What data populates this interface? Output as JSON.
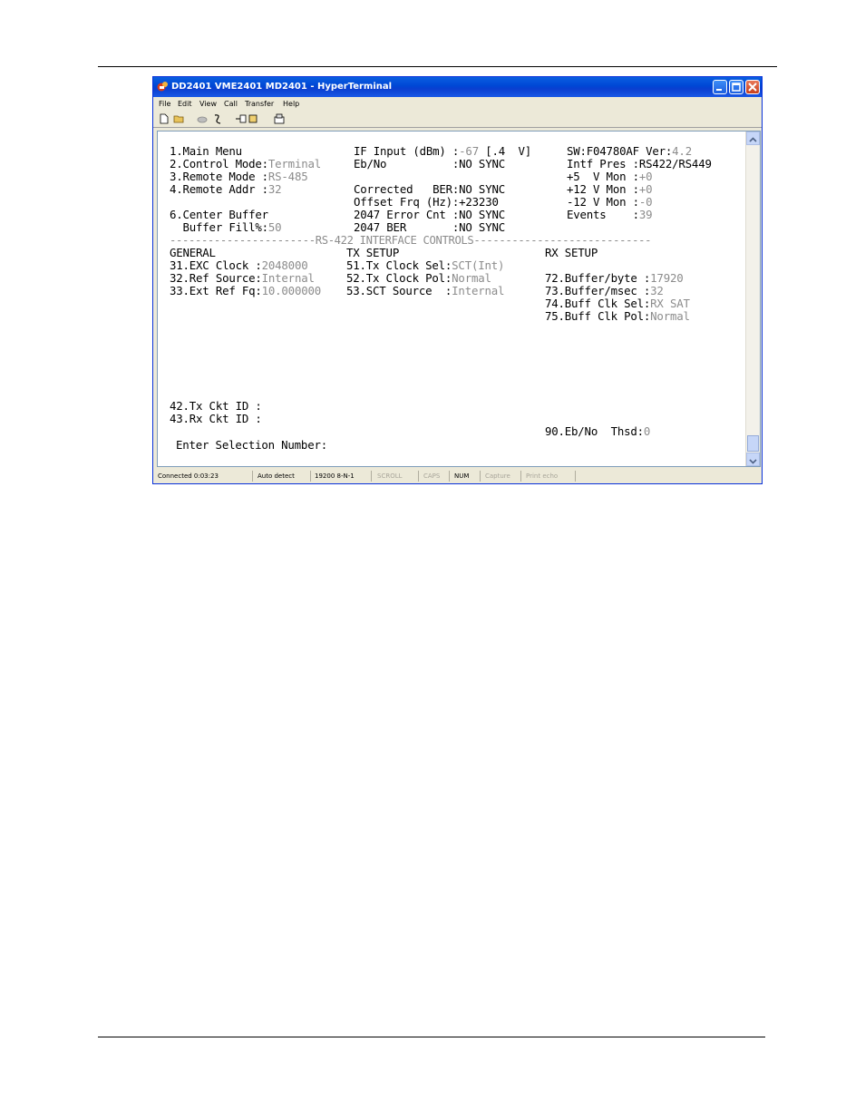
{
  "window": {
    "title": "DD2401 VME2401 MD2401 - HyperTerminal"
  },
  "menu": [
    "File",
    "Edit",
    "View",
    "Call",
    "Transfer",
    "Help"
  ],
  "toolbar_icons": [
    "new-icon",
    "open-icon",
    "dial-icon",
    "disconnect-icon",
    "send-icon",
    "properties-icon"
  ],
  "terminal": {
    "r1": {
      "a": "1.Main Menu",
      "b": "IF Input (dBm) :",
      "c": "-67",
      "d": " [.4  V]",
      "e": "SW:F04780AF Ver:",
      "f": "4.2"
    },
    "r2": {
      "a": "2.Control Mode:",
      "b": "Terminal",
      "c": "Eb/No          :NO SYNC",
      "d": "Intf Pres :RS422/RS449"
    },
    "r3": {
      "a": "3.Remote Mode :",
      "b": "RS-485",
      "c": "+5  V Mon :",
      "d": "+0"
    },
    "r4": {
      "a": "4.Remote Addr :",
      "b": "32",
      "c": "Corrected   BER:NO SYNC",
      "d": "+12 V Mon :",
      "e": "+0"
    },
    "r5": {
      "a": "Offset Frq (Hz):+23230",
      "b": "-12 V Mon :",
      "c": "-0"
    },
    "r6": {
      "a": "6.Center Buffer",
      "b": "2047 Error Cnt :NO SYNC",
      "c": "Events    :",
      "d": "39"
    },
    "r7": {
      "a": "  Buffer Fill%:",
      "b": "50",
      "c": "2047 BER       :NO SYNC"
    },
    "divider": "-----------------------RS-422 INTERFACE CONTROLS----------------------------",
    "headers": {
      "general": "GENERAL",
      "tx": "TX SETUP",
      "rx": "RX SETUP"
    },
    "g1": {
      "a": "31.EXC Clock :",
      "b": "2048000"
    },
    "g2": {
      "a": "32.Ref Source:",
      "b": "Internal"
    },
    "g3": {
      "a": "33.Ext Ref Fq:",
      "b": "10.000000"
    },
    "t1": {
      "a": "51.Tx Clock Sel:",
      "b": "SCT(Int)"
    },
    "t2": {
      "a": "52.Tx Clock Pol:",
      "b": "Normal"
    },
    "t3": {
      "a": "53.SCT Source  :",
      "b": "Internal"
    },
    "x1": {
      "a": "72.Buffer/byte :",
      "b": "17920"
    },
    "x2": {
      "a": "73.Buffer/msec :",
      "b": "32"
    },
    "x3": {
      "a": "74.Buff Clk Sel:",
      "b": "RX SAT"
    },
    "x4": {
      "a": "75.Buff Clk Pol:",
      "b": "Normal"
    },
    "ckt_tx": "42.Tx Ckt ID :",
    "ckt_rx": "43.Rx Ckt ID :",
    "ebno": {
      "a": "90.Eb/No  Thsd:",
      "b": "0"
    },
    "prompt": "Enter Selection Number:"
  },
  "status": {
    "connected": "Connected 0:03:23",
    "detect": "Auto detect",
    "settings": "19200 8-N-1",
    "scroll": "SCROLL",
    "caps": "CAPS",
    "num": "NUM",
    "capture": "Capture",
    "print_echo": "Print echo"
  },
  "colors": {
    "title_bar": "#0a5fe0",
    "dim_text": "#8c8c8c",
    "window_face": "#ece9d8"
  }
}
